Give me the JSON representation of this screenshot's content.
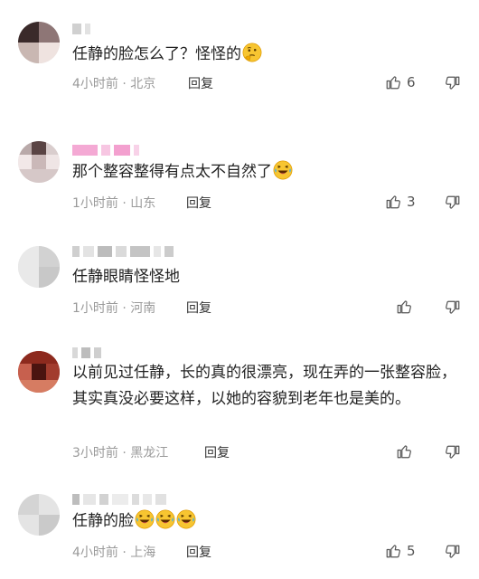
{
  "comments": [
    {
      "text": "任静的脸怎么了？怪怪的",
      "emoji": "thinking-face-emoji",
      "meta": "4小时前 · 北京",
      "reply": "回复",
      "likes": "6"
    },
    {
      "text": "那个整容整得有点太不自然了",
      "emoji": "laughing-crying-emoji",
      "meta": "1小时前 · 山东",
      "reply": "回复",
      "likes": "3"
    },
    {
      "text": "任静眼睛怪怪地",
      "meta": "1小时前 · 河南",
      "reply": "回复",
      "likes": ""
    },
    {
      "text": "以前见过任静，长的真的很漂亮，现在弄的一张整容脸，其实真没必要这样，以她的容貌到老年也是美的。",
      "meta": "3小时前 · 黑龙江",
      "reply": "回复",
      "likes": ""
    },
    {
      "text": "任静的脸",
      "emoji": "laughing-crying-emoji",
      "meta": "4小时前 · 上海",
      "reply": "回复",
      "likes": "5"
    }
  ],
  "icons": {
    "like": "thumbs-up-icon",
    "dislike": "thumbs-down-icon"
  },
  "colors": {
    "meta": "#9a9a9a",
    "text": "#222222",
    "emoji_yellow": "#f7b500"
  }
}
